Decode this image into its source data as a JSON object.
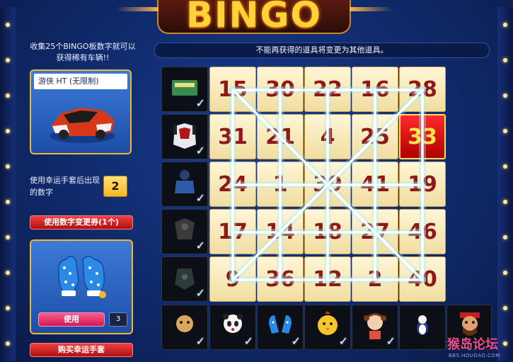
{
  "title": "BINGO",
  "left_panel": {
    "description": "收集25个BINGO板数字就可以获得稀有车辆!!",
    "car_name": "游侠 HT (无限制)",
    "car_icon": "red-race-car-icon",
    "lucky_text": "使用幸运手套后出现的数字",
    "lucky_number": "2",
    "change_button": "使用数字变更券(1个)",
    "glove_icon": "blue-polka-dot-gloves-icon",
    "use_button": "使用",
    "use_count": "3",
    "buy_button": "购买幸运手套"
  },
  "notice": "不能再获得的道具将变更为其他道具。",
  "board": {
    "rows": [
      [
        "15",
        "30",
        "22",
        "16",
        "28"
      ],
      [
        "31",
        "21",
        "4",
        "25",
        "33"
      ],
      [
        "24",
        "1",
        "39",
        "41",
        "19"
      ],
      [
        "17",
        "14",
        "18",
        "27",
        "46"
      ],
      [
        "9",
        "36",
        "12",
        "2",
        "40"
      ]
    ],
    "highlighted": "33",
    "row_rewards": [
      {
        "icon": "voucher-card-icon",
        "claimed": true
      },
      {
        "icon": "white-kart-icon",
        "claimed": true
      },
      {
        "icon": "character-outfit-icon",
        "claimed": true
      },
      {
        "icon": "dark-armor-icon",
        "claimed": true
      },
      {
        "icon": "dark-accessory-icon",
        "claimed": true
      }
    ],
    "col_rewards": [
      {
        "icon": "dog-character-icon",
        "claimed": true
      },
      {
        "icon": "panda-character-icon",
        "claimed": true
      },
      {
        "icon": "gloves-item-icon",
        "claimed": true
      },
      {
        "icon": "chicken-character-icon",
        "claimed": true
      },
      {
        "icon": "girl-character-icon",
        "claimed": true
      },
      {
        "icon": "penguin-pet-icon",
        "claimed": false
      },
      {
        "icon": "warrior-character-icon",
        "claimed": false
      }
    ],
    "check_glyph": "✓"
  },
  "watermark": {
    "logo": "猴岛论坛",
    "url": "BBS.HOUDAO.COM"
  },
  "colors": {
    "accent_gold": "#f3b72a",
    "tile_red": "#8e1818",
    "line_cyan": "#9ff2ff"
  }
}
